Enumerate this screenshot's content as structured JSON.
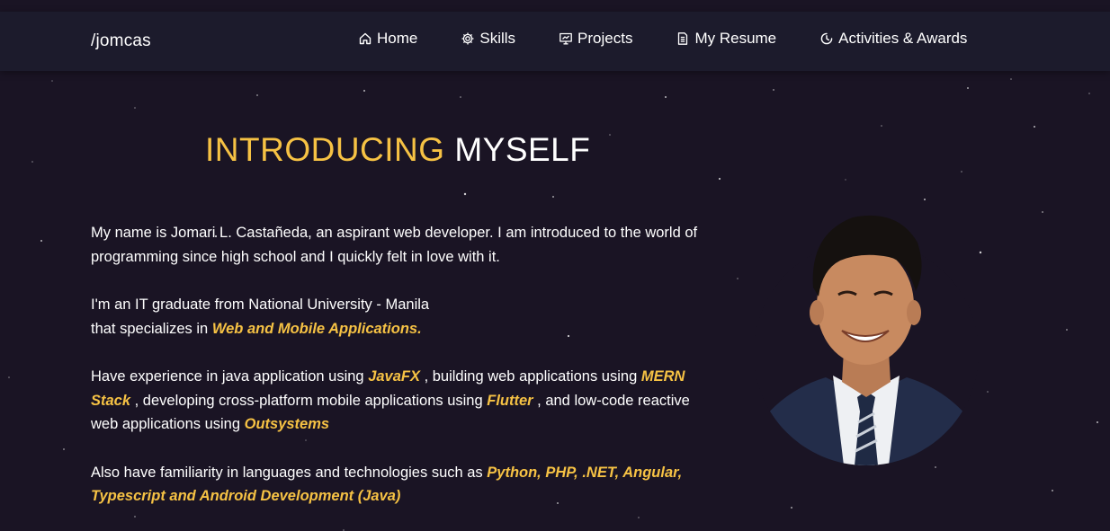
{
  "brand": "/jomcas",
  "nav": {
    "items": [
      {
        "label": "Home",
        "icon": "home-icon"
      },
      {
        "label": "Skills",
        "icon": "gear-icon"
      },
      {
        "label": "Projects",
        "icon": "presentation-icon"
      },
      {
        "label": "My Resume",
        "icon": "document-icon"
      },
      {
        "label": "Activities & Awards",
        "icon": "clock-icon"
      }
    ]
  },
  "heading": {
    "accent": "INTRODUCING",
    "plain": "MYSELF"
  },
  "intro": {
    "p1": "My name is Jomari L. Castañeda, an aspirant web developer. I am introduced to the world of programming since high school and I quickly felt in love with it.",
    "p2_line1": "I'm an IT graduate from National University - Manila",
    "p2_line2_pre": "that specializes in ",
    "p2_highlight": "Web and Mobile Applications.",
    "p3_pre1": "Have experience in java application using ",
    "p3_h1": "JavaFX",
    "p3_pre2": " , building web applications using ",
    "p3_h2": "MERN Stack",
    "p3_pre3": " , developing cross-platform mobile applications using ",
    "p3_h3": "Flutter",
    "p3_pre4": " , and low-code reactive web applications using ",
    "p3_h4": "Outsystems",
    "p4_pre": "Also have familiarity in languages and technologies such as ",
    "p4_highlight": "Python, PHP, .NET, Angular, Typescript and Android Development (Java)"
  },
  "colors": {
    "background": "#1a1424",
    "navbar": "#1c1b2c",
    "accent": "#f6c244",
    "text": "#ffffff"
  }
}
